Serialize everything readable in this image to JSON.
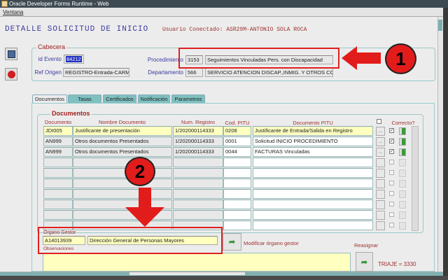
{
  "window": {
    "title": "Oracle Developer Forms Runtime - Web"
  },
  "menu": {
    "items": [
      "Ventana"
    ]
  },
  "header": {
    "title": "DETALLE SOLICITUD DE INICIO",
    "user": "Usuario Conectado: ASR29M-ANTONIO SOLA ROCA"
  },
  "cabecera": {
    "label": "Cabecera",
    "id_evento_label": "id Evento",
    "id_evento": "84212",
    "ref_origen_label": "Ref Origen",
    "ref_origen": "REGISTRO-Entrada-CARM:",
    "procedimiento_label": "Procedimiento",
    "procedimiento_code": "3153",
    "procedimiento_name": "Seguimientos Vinculadas Pers. con Discapacidad",
    "departamento_label": "Departamento",
    "departamento_code": "566",
    "departamento_name": "SERVICIO ATENCION DISCAP.,INMIG. Y OTROS COLI"
  },
  "tabs": [
    "Documentos",
    "Tasas",
    "Certificados",
    "Notificación",
    "Parametros"
  ],
  "documentos": {
    "label": "Documentos",
    "columns": [
      "Documento",
      "Nombre Documento",
      "Num. Registro",
      "Cod. PITU",
      "Documento PITU",
      "Correcto?"
    ],
    "rows": [
      {
        "doc": "JDI005",
        "nombre": "Justificante de presentación",
        "num": "1/202000114333",
        "cod": "0208",
        "pitu": "Justificante de Entrada/Salida en Registro",
        "correcto": true
      },
      {
        "doc": "AN999",
        "nombre": "Otros documentos Presentados",
        "num": "1/202000114333",
        "cod": "0001",
        "pitu": "Solicitud INICIO PROCEDIMIENTO",
        "correcto": true
      },
      {
        "doc": "AN999",
        "nombre": "Otros documentos Presentados",
        "num": "1/202000114333",
        "cod": "0044",
        "pitu": "FACTURAS Vinculadas",
        "correcto": true
      }
    ],
    "empty_rows": 7,
    "dots_label": "..."
  },
  "organo": {
    "label": "Órgano Gestor",
    "code": "A14013939",
    "name": "Dirección General de Personas Mayores",
    "modify_label": "Modificar órgano gestor"
  },
  "observaciones": {
    "label": "Observaciones",
    "value": ""
  },
  "reasignar": {
    "label": "Reasignar",
    "triaje": "TRIAJE = 3330"
  },
  "annotations": {
    "one": "1",
    "two": "2"
  },
  "colors": {
    "annotation_red": "#e21b1b",
    "tab_teal": "#7fc0c0",
    "highlight_yellow": "#ffffc0"
  }
}
